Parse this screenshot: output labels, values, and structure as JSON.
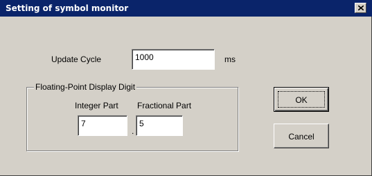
{
  "window": {
    "title": "Setting of symbol monitor",
    "close_icon": "close-icon"
  },
  "update_cycle": {
    "label": "Update Cycle",
    "value": "1000",
    "unit": "ms"
  },
  "floating_point": {
    "group_label": "Floating-Point Display Digit",
    "integer_label": "Integer Part",
    "fractional_label": "Fractional Part",
    "integer_value": "7",
    "separator": ".",
    "fractional_value": "5"
  },
  "buttons": {
    "ok_label": "OK",
    "cancel_label": "Cancel"
  },
  "colors": {
    "titlebar": "#0a246a",
    "dialog_face": "#d4d0c8"
  }
}
